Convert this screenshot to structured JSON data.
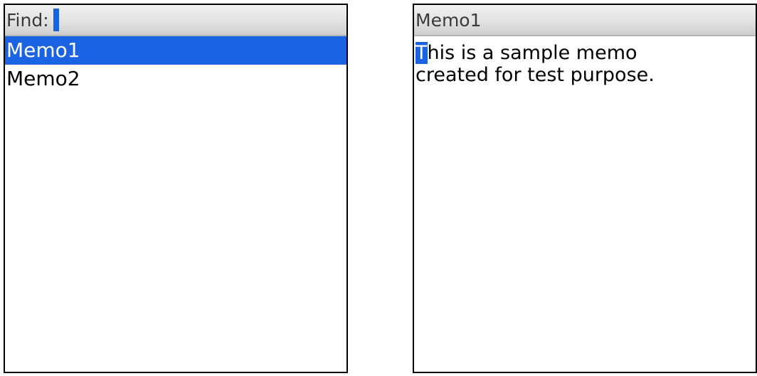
{
  "list_screen": {
    "find_label": "Find:",
    "find_value": "",
    "items": [
      {
        "label": "Memo1",
        "selected": true
      },
      {
        "label": "Memo2",
        "selected": false
      }
    ]
  },
  "memo_screen": {
    "title": "Memo1",
    "cursor_char": "T",
    "line1_rest": "his is a sample memo",
    "line2": "created for test purpose."
  },
  "colors": {
    "selection": "#1c63e3",
    "titlebar": "#e2e2e2",
    "border": "#000000"
  }
}
